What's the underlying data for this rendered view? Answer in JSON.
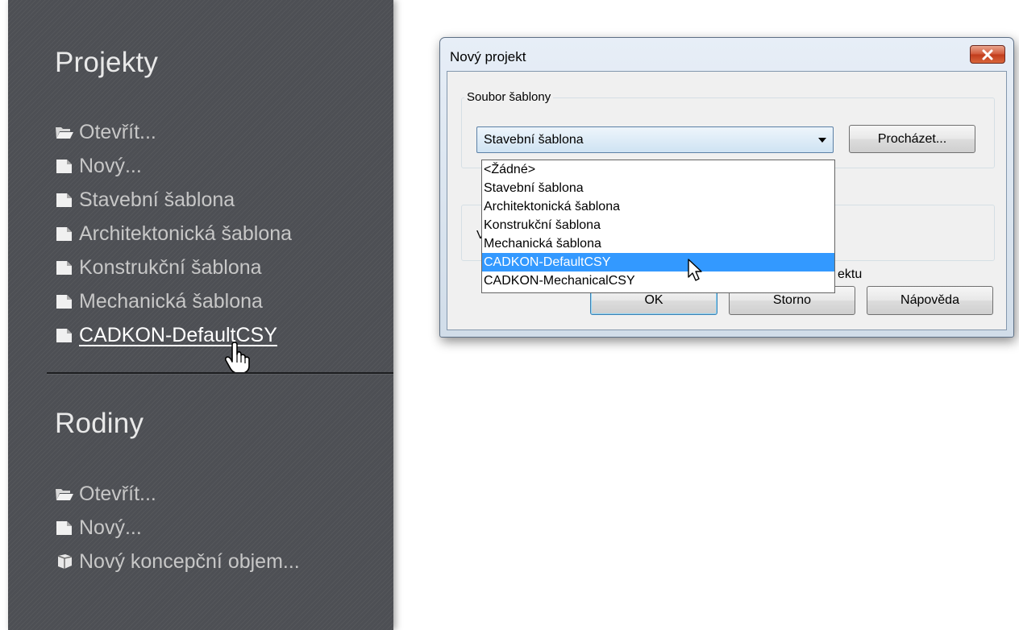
{
  "left_panel": {
    "projects": {
      "title": "Projekty",
      "items": [
        {
          "label": "Otevřít...",
          "icon": "folder-open-icon"
        },
        {
          "label": "Nový...",
          "icon": "document-icon"
        },
        {
          "label": "Stavební šablona",
          "icon": "document-icon"
        },
        {
          "label": "Architektonická šablona",
          "icon": "document-icon"
        },
        {
          "label": "Konstrukční šablona",
          "icon": "document-icon"
        },
        {
          "label": "Mechanická šablona",
          "icon": "document-icon"
        },
        {
          "label": "CADKON-DefaultCSY",
          "icon": "document-icon",
          "hovered": true
        }
      ]
    },
    "families": {
      "title": "Rodiny",
      "items": [
        {
          "label": "Otevřít...",
          "icon": "folder-open-icon"
        },
        {
          "label": "Nový...",
          "icon": "document-icon"
        },
        {
          "label": "Nový koncepční objem...",
          "icon": "cube-document-icon"
        }
      ]
    },
    "cursor": "hand-pointer-icon"
  },
  "dialog": {
    "title": "Nový projekt",
    "close_icon": "close-icon",
    "template_group": {
      "label": "Soubor šablony",
      "combo_value": "Stavební šablona",
      "browse_label": "Procházet..."
    },
    "second_group": {
      "label_visible": "V",
      "option_text_visible": "ektu"
    },
    "dropdown": {
      "options": [
        "<Žádné>",
        "Stavební šablona",
        "Architektonická šablona",
        "Konstrukční šablona",
        "Mechanická šablona",
        "CADKON-DefaultCSY",
        "CADKON-MechanicalCSY"
      ],
      "highlighted_index": 5
    },
    "buttons": {
      "ok": "OK",
      "cancel": "Storno",
      "help": "Nápověda"
    },
    "cursor": "arrow-pointer-icon"
  },
  "colors": {
    "panel_bg": "#4d4f54",
    "panel_text": "#c7c7c7",
    "highlight": "#3399ff",
    "close_button": "#c13b1c"
  }
}
